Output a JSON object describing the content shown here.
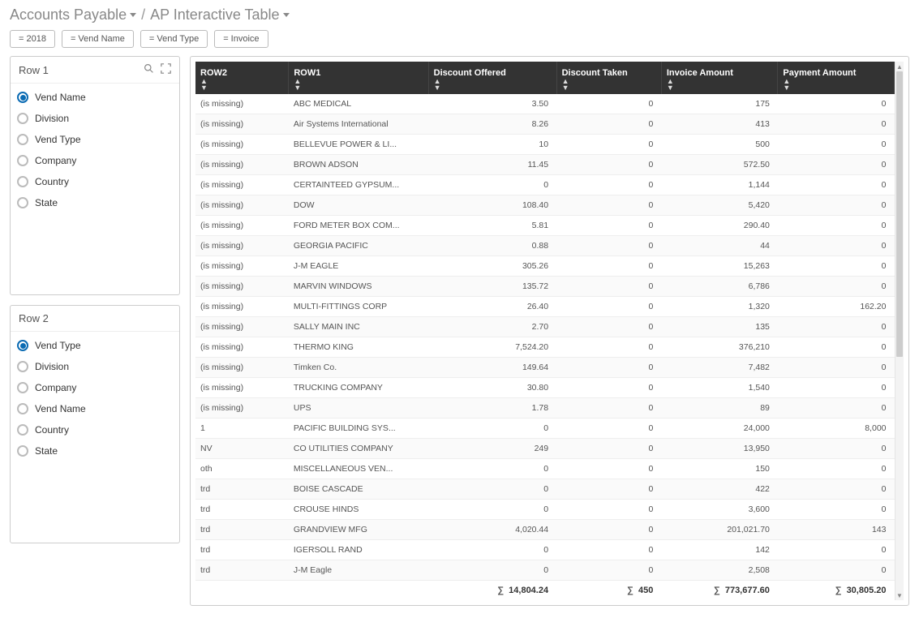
{
  "breadcrumb": {
    "parent": "Accounts Payable",
    "current": "AP Interactive Table"
  },
  "filters": [
    {
      "label": "= 2018"
    },
    {
      "label": "= Vend Name"
    },
    {
      "label": "= Vend Type"
    },
    {
      "label": "= Invoice"
    }
  ],
  "row1_panel": {
    "title": "Row 1",
    "options": [
      {
        "label": "Vend Name",
        "checked": true
      },
      {
        "label": "Division",
        "checked": false
      },
      {
        "label": "Vend Type",
        "checked": false
      },
      {
        "label": "Company",
        "checked": false
      },
      {
        "label": "Country",
        "checked": false
      },
      {
        "label": "State",
        "checked": false
      }
    ]
  },
  "row2_panel": {
    "title": "Row 2",
    "options": [
      {
        "label": "Vend Type",
        "checked": true
      },
      {
        "label": "Division",
        "checked": false
      },
      {
        "label": "Company",
        "checked": false
      },
      {
        "label": "Vend Name",
        "checked": false
      },
      {
        "label": "Country",
        "checked": false
      },
      {
        "label": "State",
        "checked": false
      }
    ]
  },
  "table": {
    "headers": [
      "ROW2",
      "ROW1",
      "Discount Offered",
      "Discount Taken",
      "Invoice Amount",
      "Payment Amount"
    ],
    "rows": [
      {
        "row2": "(is missing)",
        "row1": "ABC MEDICAL",
        "discOffered": "3.50",
        "discTaken": "0",
        "invoice": "175",
        "payment": "0"
      },
      {
        "row2": "(is missing)",
        "row1": "Air Systems International",
        "discOffered": "8.26",
        "discTaken": "0",
        "invoice": "413",
        "payment": "0"
      },
      {
        "row2": "(is missing)",
        "row1": "BELLEVUE POWER & LI...",
        "discOffered": "10",
        "discTaken": "0",
        "invoice": "500",
        "payment": "0"
      },
      {
        "row2": "(is missing)",
        "row1": "BROWN ADSON",
        "discOffered": "11.45",
        "discTaken": "0",
        "invoice": "572.50",
        "payment": "0"
      },
      {
        "row2": "(is missing)",
        "row1": "CERTAINTEED GYPSUM...",
        "discOffered": "0",
        "discTaken": "0",
        "invoice": "1,144",
        "payment": "0"
      },
      {
        "row2": "(is missing)",
        "row1": "DOW",
        "discOffered": "108.40",
        "discTaken": "0",
        "invoice": "5,420",
        "payment": "0"
      },
      {
        "row2": "(is missing)",
        "row1": "FORD METER BOX COM...",
        "discOffered": "5.81",
        "discTaken": "0",
        "invoice": "290.40",
        "payment": "0"
      },
      {
        "row2": "(is missing)",
        "row1": "GEORGIA PACIFIC",
        "discOffered": "0.88",
        "discTaken": "0",
        "invoice": "44",
        "payment": "0"
      },
      {
        "row2": "(is missing)",
        "row1": "J-M EAGLE",
        "discOffered": "305.26",
        "discTaken": "0",
        "invoice": "15,263",
        "payment": "0"
      },
      {
        "row2": "(is missing)",
        "row1": "MARVIN WINDOWS",
        "discOffered": "135.72",
        "discTaken": "0",
        "invoice": "6,786",
        "payment": "0"
      },
      {
        "row2": "(is missing)",
        "row1": "MULTI-FITTINGS CORP",
        "discOffered": "26.40",
        "discTaken": "0",
        "invoice": "1,320",
        "payment": "162.20"
      },
      {
        "row2": "(is missing)",
        "row1": "SALLY MAIN INC",
        "discOffered": "2.70",
        "discTaken": "0",
        "invoice": "135",
        "payment": "0"
      },
      {
        "row2": "(is missing)",
        "row1": "THERMO KING",
        "discOffered": "7,524.20",
        "discTaken": "0",
        "invoice": "376,210",
        "payment": "0"
      },
      {
        "row2": "(is missing)",
        "row1": "Timken Co.",
        "discOffered": "149.64",
        "discTaken": "0",
        "invoice": "7,482",
        "payment": "0"
      },
      {
        "row2": "(is missing)",
        "row1": "TRUCKING COMPANY",
        "discOffered": "30.80",
        "discTaken": "0",
        "invoice": "1,540",
        "payment": "0"
      },
      {
        "row2": "(is missing)",
        "row1": "UPS",
        "discOffered": "1.78",
        "discTaken": "0",
        "invoice": "89",
        "payment": "0"
      },
      {
        "row2": "1",
        "row1": "PACIFIC BUILDING SYS...",
        "discOffered": "0",
        "discTaken": "0",
        "invoice": "24,000",
        "payment": "8,000"
      },
      {
        "row2": "NV",
        "row1": "CO UTILITIES COMPANY",
        "discOffered": "249",
        "discTaken": "0",
        "invoice": "13,950",
        "payment": "0"
      },
      {
        "row2": "oth",
        "row1": "MISCELLANEOUS VEN...",
        "discOffered": "0",
        "discTaken": "0",
        "invoice": "150",
        "payment": "0"
      },
      {
        "row2": "trd",
        "row1": "BOISE CASCADE",
        "discOffered": "0",
        "discTaken": "0",
        "invoice": "422",
        "payment": "0"
      },
      {
        "row2": "trd",
        "row1": "CROUSE HINDS",
        "discOffered": "0",
        "discTaken": "0",
        "invoice": "3,600",
        "payment": "0"
      },
      {
        "row2": "trd",
        "row1": "GRANDVIEW MFG",
        "discOffered": "4,020.44",
        "discTaken": "0",
        "invoice": "201,021.70",
        "payment": "143"
      },
      {
        "row2": "trd",
        "row1": "IGERSOLL RAND",
        "discOffered": "0",
        "discTaken": "0",
        "invoice": "142",
        "payment": "0"
      },
      {
        "row2": "trd",
        "row1": "J-M Eagle",
        "discOffered": "0",
        "discTaken": "0",
        "invoice": "2,508",
        "payment": "0"
      }
    ],
    "totals": {
      "discOffered": "14,804.24",
      "discTaken": "450",
      "invoice": "773,677.60",
      "payment": "30,805.20"
    }
  }
}
